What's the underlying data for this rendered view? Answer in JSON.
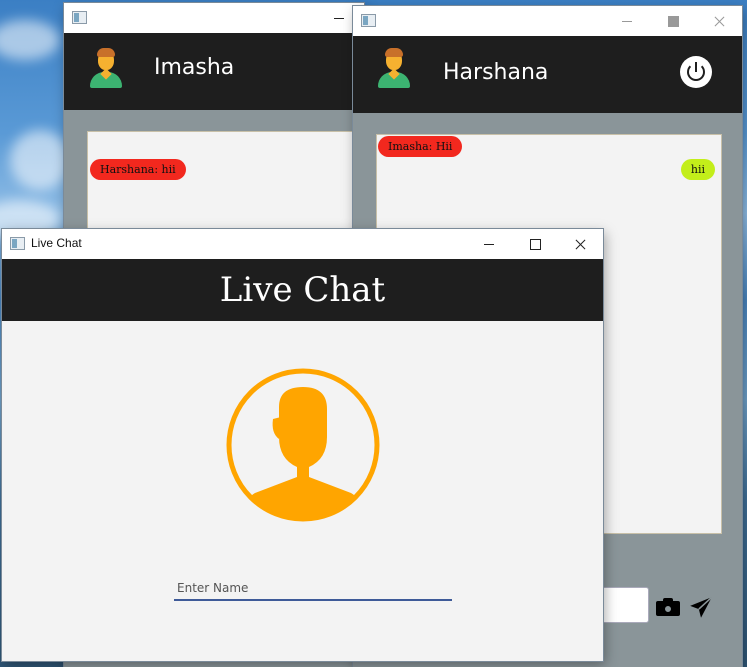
{
  "imasha_window": {
    "title": "",
    "user_name": "Imasha",
    "messages": [
      {
        "text": "Harshana: hii",
        "side": "left",
        "color": "#f2281e"
      }
    ]
  },
  "harshana_window": {
    "title": "",
    "user_name": "Harshana",
    "messages": [
      {
        "text": "Imasha: Hii",
        "side": "left",
        "color": "#f2281e"
      },
      {
        "text": "hii",
        "side": "right",
        "color": "#c3ee1a"
      }
    ],
    "icons": [
      "user-icon",
      "power-icon",
      "camera-icon",
      "send-icon"
    ]
  },
  "live_chat_window": {
    "title": "Live Chat",
    "header_title": "Live Chat",
    "name_input": {
      "value": "",
      "placeholder": "Enter Name"
    },
    "accent_color": "#ffa500"
  },
  "colors": {
    "header": "#1e1e1e",
    "chat_bg": "#8a9599",
    "input_underline": "#3e5a98"
  }
}
